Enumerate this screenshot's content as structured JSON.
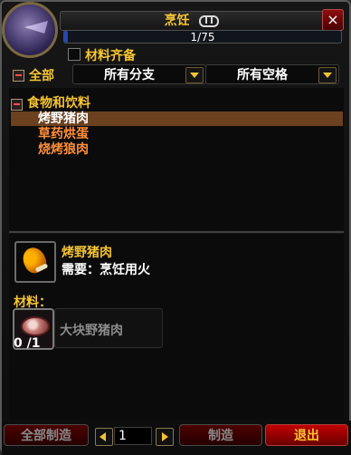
{
  "window": {
    "title": "烹饪",
    "progress": {
      "text": "1/75",
      "current": 1,
      "max": 75
    },
    "filter_checkbox_label": "材料齐备",
    "close_label": "×"
  },
  "filters": {
    "all_label": "全部",
    "subclass_value": "所有分支",
    "slot_value": "所有空格"
  },
  "recipes": {
    "category": "食物和饮料",
    "items": [
      {
        "label": "烤野猪肉",
        "selected": true
      },
      {
        "label": "草药烘蛋",
        "selected": false
      },
      {
        "label": "烧烤狼肉",
        "selected": false
      }
    ]
  },
  "detail": {
    "item_name": "烤野猪肉",
    "requires": "需要：烹饪用火",
    "materials_label": "材料：",
    "reagent": {
      "name": "大块野猪肉",
      "count": "0 /1"
    }
  },
  "footer": {
    "create_all_label": "全部制造",
    "quantity": "1",
    "create_label": "制造",
    "exit_label": "退出"
  },
  "colors": {
    "title_gold": "#f6c532",
    "recipe_orange": "#ff8f3a",
    "selected_bg": "#6b4120",
    "progress_blue": "#2146b8"
  },
  "icons": [
    "link-icon",
    "close-icon",
    "drumstick-icon",
    "meat-icon",
    "chevron-down-icon",
    "arrow-left-icon",
    "arrow-right-icon"
  ]
}
